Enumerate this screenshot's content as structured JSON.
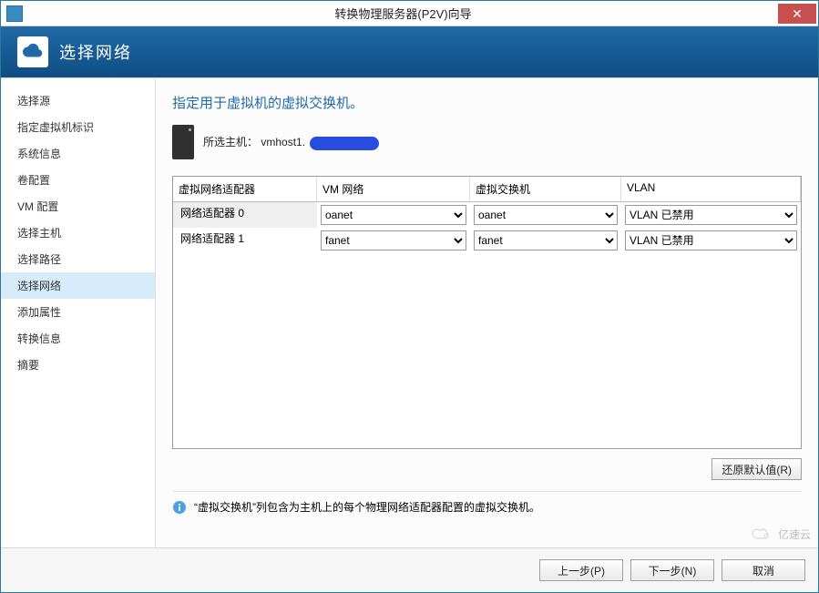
{
  "window": {
    "title": "转换物理服务器(P2V)向导",
    "close_glyph": "✕"
  },
  "banner": {
    "title": "选择网络"
  },
  "sidebar": {
    "items": [
      {
        "label": "选择源",
        "selected": false
      },
      {
        "label": "指定虚拟机标识",
        "selected": false
      },
      {
        "label": "系统信息",
        "selected": false
      },
      {
        "label": "卷配置",
        "selected": false
      },
      {
        "label": "VM 配置",
        "selected": false
      },
      {
        "label": "选择主机",
        "selected": false
      },
      {
        "label": "选择路径",
        "selected": false
      },
      {
        "label": "选择网络",
        "selected": true
      },
      {
        "label": "添加属性",
        "selected": false
      },
      {
        "label": "转换信息",
        "selected": false
      },
      {
        "label": "摘要",
        "selected": false
      }
    ]
  },
  "main": {
    "heading": "指定用于虚拟机的虚拟交换机。",
    "host_label": "所选主机：",
    "host_value": "vmhost1.",
    "columns": {
      "adapter": "虚拟网络适配器",
      "vmnet": "VM 网络",
      "vswitch": "虚拟交换机",
      "vlan": "VLAN"
    },
    "rows": [
      {
        "adapter": "网络适配器 0",
        "vmnet": "oanet",
        "vswitch": "oanet",
        "vlan": "VLAN 已禁用",
        "sel": true
      },
      {
        "adapter": "网络适配器 1",
        "vmnet": "fanet",
        "vswitch": "fanet",
        "vlan": "VLAN 已禁用",
        "sel": false
      }
    ],
    "restore_defaults": "还原默认值(R)",
    "info_text": "“虚拟交换机”列包含为主机上的每个物理网络适配器配置的虚拟交换机。"
  },
  "footer": {
    "prev": "上一步(P)",
    "next": "下一步(N)",
    "cancel": "取消"
  },
  "watermark": "亿速云"
}
